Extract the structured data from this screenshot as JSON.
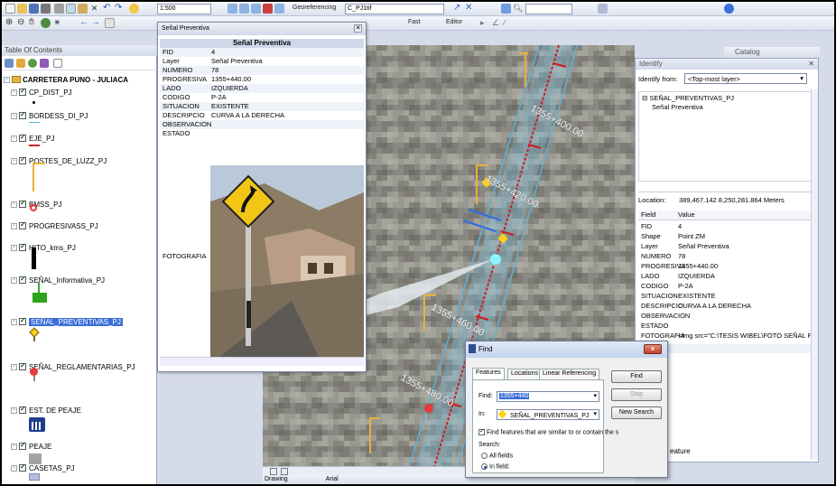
{
  "toolbar": {
    "scale": "1:500",
    "georef_label": "Georeferencing",
    "georef_layer": "C_PJ1tif",
    "editor_label": "Editor",
    "fast_label": "Fast"
  },
  "toc": {
    "title": "Table Of Contents",
    "group": "CARRETERA PUNO - JULIACA",
    "layers": [
      {
        "name": "CP_DIST_PJ"
      },
      {
        "name": "BORDESS_DI_PJ"
      },
      {
        "name": "EJE_PJ"
      },
      {
        "name": "POSTES_DE_LUZZ_PJ"
      },
      {
        "name": "BMSS_PJ"
      },
      {
        "name": "PROGRESIVASS_PJ"
      },
      {
        "name": "HITO_kms_PJ"
      },
      {
        "name": "SEÑAL_Informativa_PJ"
      },
      {
        "name": "SEÑAL_PREVENTIVAS_PJ"
      },
      {
        "name": "SEÑAL_REGLAMENTARIAS_PJ"
      },
      {
        "name": "EST. DE PEAJE"
      },
      {
        "name": "PEAJE"
      },
      {
        "name": "CASETAS_PJ"
      }
    ]
  },
  "popup": {
    "window_title": "Señal Preventiva",
    "table_title": "Señal Preventiva",
    "rows": [
      {
        "k": "FID",
        "v": "4"
      },
      {
        "k": "Layer",
        "v": "Señal Preventiva"
      },
      {
        "k": "NUMERO",
        "v": "78"
      },
      {
        "k": "PROGRESIVA",
        "v": "1355+440.00"
      },
      {
        "k": "LADO",
        "v": "IZQUIERDA"
      },
      {
        "k": "CODIGO",
        "v": "P-2A"
      },
      {
        "k": "SITUACION",
        "v": "EXISTENTE"
      },
      {
        "k": "DESCRIPCIO",
        "v": "CURVA A LA DERECHA"
      },
      {
        "k": "OBSERVACION",
        "v": ""
      },
      {
        "k": "ESTADO",
        "v": ""
      }
    ],
    "photo_label": "FOTOGRAFIA"
  },
  "map": {
    "progresivas": [
      "1355+400.00",
      "1355+420.00",
      "1355+460.00",
      "1355+480.00"
    ]
  },
  "catalog": {
    "label": "Catalog"
  },
  "identify": {
    "title": "Identify",
    "from_label": "Identify from:",
    "from_value": "<Top-most layer>",
    "tree_layer": "SEÑAL_PREVENTIVAS_PJ",
    "tree_item": "Señal Preventiva",
    "location_label": "Location:",
    "location_value": "389,467.142  8,250,281.864 Meters",
    "col_field": "Field",
    "col_value": "Value",
    "rows": [
      {
        "k": "FID",
        "v": "4"
      },
      {
        "k": "Shape",
        "v": "Point ZM"
      },
      {
        "k": "Layer",
        "v": "Señal Preventiva"
      },
      {
        "k": "NUMERO",
        "v": "78"
      },
      {
        "k": "PROGRESIVA",
        "v": "1355+440.00"
      },
      {
        "k": "LADO",
        "v": "IZQUIERDA"
      },
      {
        "k": "CODIGO",
        "v": "P-2A"
      },
      {
        "k": "SITUACION",
        "v": "EXISTENTE"
      },
      {
        "k": "DESCRIPCIO",
        "v": "CURVA A LA DERECHA"
      },
      {
        "k": "OBSERVACION",
        "v": ""
      },
      {
        "k": "ESTADO",
        "v": ""
      },
      {
        "k": "FOTOGRAFIA",
        "v": "<img src=\"C:\\TESIS WIBEL\\FOTO SEÑAL PREVENTIV"
      }
    ],
    "bottom_fragment": "eature"
  },
  "find": {
    "title": "Find",
    "tabs": [
      "Features",
      "Locations",
      "Linear Referencing"
    ],
    "find_label": "Find:",
    "find_value": "1355+440",
    "in_label": "In:",
    "in_value": "SEÑAL_PREVENTIVAS_PJ",
    "similar_label": "Find features that are similar to or contain the s",
    "search_label": "Search:",
    "all_fields": "All fields",
    "in_field": "In field:",
    "btn_find": "Find",
    "btn_stop": "Stop",
    "btn_new": "New Search"
  },
  "statusbar": {
    "text": "Drawing",
    "font": "Arial"
  }
}
